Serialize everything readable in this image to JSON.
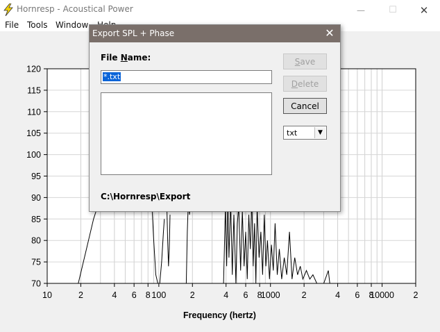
{
  "window": {
    "title": "Hornresp - Acoustical Power",
    "minimize_glyph": "—",
    "maximize_glyph": "☐",
    "close_glyph": "✕"
  },
  "menu": {
    "items": [
      "File",
      "Tools",
      "Window",
      "Help"
    ]
  },
  "chart_data": {
    "type": "line",
    "xlabel": "Frequency (hertz)",
    "x_scale": "log",
    "xlim": [
      10,
      20000
    ],
    "ylim": [
      70,
      120
    ],
    "x_tick_labels": [
      {
        "v": 10,
        "t": "10"
      },
      {
        "v": 20,
        "t": "2"
      },
      {
        "v": 40,
        "t": "4"
      },
      {
        "v": 60,
        "t": "6"
      },
      {
        "v": 80,
        "t": "8"
      },
      {
        "v": 100,
        "t": "100"
      },
      {
        "v": 200,
        "t": "2"
      },
      {
        "v": 400,
        "t": "4"
      },
      {
        "v": 600,
        "t": "6"
      },
      {
        "v": 800,
        "t": "8"
      },
      {
        "v": 1000,
        "t": "1000"
      },
      {
        "v": 2000,
        "t": "2"
      },
      {
        "v": 4000,
        "t": "4"
      },
      {
        "v": 6000,
        "t": "6"
      },
      {
        "v": 8000,
        "t": "8"
      },
      {
        "v": 10000,
        "t": "10000"
      },
      {
        "v": 20000,
        "t": "2"
      }
    ],
    "y_ticks": [
      70,
      75,
      80,
      85,
      90,
      95,
      100,
      105,
      110,
      115,
      120
    ],
    "grid": true,
    "series": [
      {
        "values": [
          [
            19,
            70
          ],
          [
            22,
            77
          ],
          [
            26,
            85
          ],
          [
            30,
            90
          ]
        ]
      },
      {
        "values": [
          [
            86,
            90
          ],
          [
            90,
            80
          ],
          [
            94,
            72
          ],
          [
            98,
            70
          ],
          [
            102,
            70
          ],
          [
            106,
            75
          ],
          [
            110,
            82
          ],
          [
            112,
            85
          ]
        ]
      },
      {
        "values": [
          [
            118,
            88
          ],
          [
            120,
            80
          ],
          [
            122,
            74
          ],
          [
            124,
            78
          ],
          [
            126,
            86
          ]
        ]
      },
      {
        "values": [
          [
            176,
            70
          ],
          [
            180,
            82
          ],
          [
            184,
            90
          ],
          [
            188,
            86
          ],
          [
            194,
            90
          ]
        ]
      },
      {
        "values": [
          [
            380,
            70
          ],
          [
            395,
            88
          ],
          [
            405,
            74
          ],
          [
            415,
            90
          ],
          [
            425,
            76
          ],
          [
            440,
            89
          ],
          [
            455,
            72
          ],
          [
            470,
            86
          ],
          [
            490,
            70
          ],
          [
            505,
            84
          ],
          [
            520,
            88
          ],
          [
            540,
            73
          ],
          [
            560,
            87
          ],
          [
            580,
            74
          ],
          [
            600,
            82
          ],
          [
            620,
            71
          ],
          [
            640,
            86
          ],
          [
            660,
            78
          ],
          [
            680,
            90
          ],
          [
            700,
            74
          ],
          [
            720,
            84
          ],
          [
            740,
            70
          ],
          [
            760,
            88
          ],
          [
            790,
            76
          ],
          [
            820,
            82
          ],
          [
            850,
            72
          ],
          [
            880,
            86
          ],
          [
            910,
            74
          ],
          [
            940,
            80
          ],
          [
            980,
            71
          ],
          [
            1020,
            79
          ],
          [
            1060,
            73
          ],
          [
            1100,
            84
          ],
          [
            1150,
            72
          ],
          [
            1200,
            78
          ],
          [
            1260,
            71
          ],
          [
            1330,
            76
          ],
          [
            1400,
            72
          ],
          [
            1480,
            82
          ],
          [
            1560,
            71
          ],
          [
            1650,
            76
          ],
          [
            1750,
            72
          ],
          [
            1850,
            74
          ],
          [
            1950,
            71
          ],
          [
            2100,
            73
          ],
          [
            2250,
            71
          ],
          [
            2400,
            72
          ],
          [
            2600,
            70
          ],
          [
            3000,
            70
          ],
          [
            3300,
            73
          ],
          [
            3400,
            70
          ]
        ]
      }
    ]
  },
  "dialog": {
    "title": "Export SPL + Phase",
    "close_glyph": "✕",
    "file_name_label_pre": "File ",
    "file_name_label_u": "N",
    "file_name_label_post": "ame:",
    "file_name_value": "*.txt",
    "save_pre": "",
    "save_u": "S",
    "save_post": "ave",
    "delete_pre": "",
    "delete_u": "D",
    "delete_post": "elete",
    "cancel_label": "Cancel",
    "extension_value": "txt",
    "path": "C:\\Hornresp\\Export"
  }
}
